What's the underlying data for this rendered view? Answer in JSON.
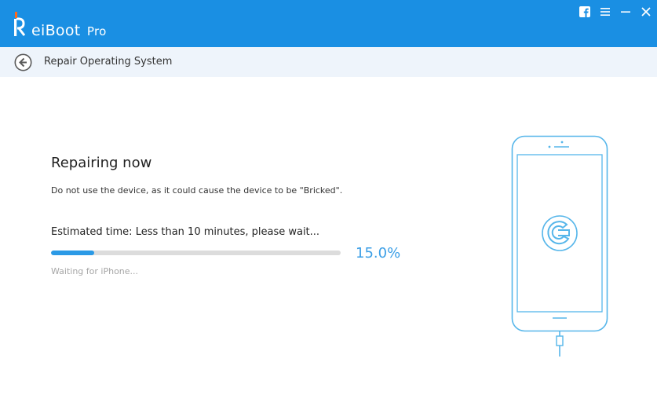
{
  "app": {
    "name": "ReiBoot",
    "name_rest": "eiBoot",
    "edition": "Pro",
    "brand_color": "#1a8fe3",
    "accent_color": "#ff6a1a"
  },
  "window_controls": {
    "facebook": "facebook-icon",
    "menu": "menu-icon",
    "minimize": "minimize-icon",
    "close": "close-icon"
  },
  "header": {
    "back_icon": "back-arrow-icon",
    "title": "Repair Operating System"
  },
  "main": {
    "title": "Repairing now",
    "warning": "Do not use the device, as it could cause the device to be \"Bricked\".",
    "estimated": "Estimated time: Less than 10 minutes, please wait...",
    "progress_value": 15.0,
    "progress_label": "15.0%",
    "progress_color": "#2b9ae6",
    "status": "Waiting for iPhone..."
  },
  "illustration": {
    "device": "iphone-outline",
    "icon": "repair-wrench-icon",
    "line_color": "#56b6ea"
  }
}
